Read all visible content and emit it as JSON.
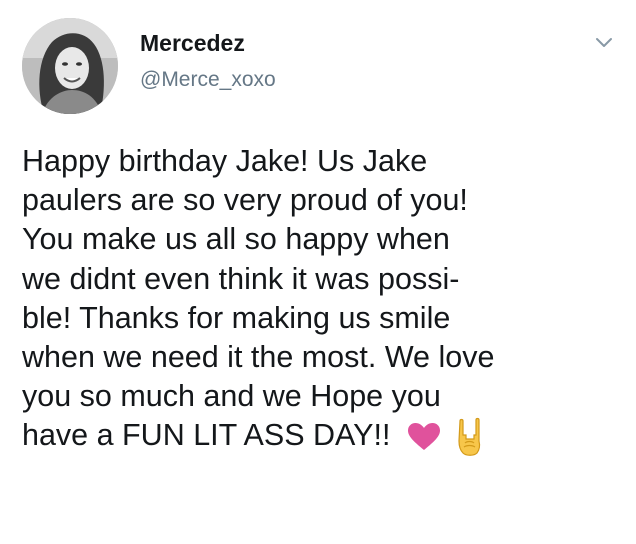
{
  "tweet": {
    "author": {
      "display_name": "Mercedez",
      "handle": "@Merce_xoxo"
    },
    "body_lines": [
      "Happy birthday Jake! Us Jake",
      "paulers are so very proud of you!",
      "You make us all so happy when",
      "we didnt even think it was possi-",
      "ble! Thanks for making us smile",
      "when we need it the most. We love",
      "you so much and we Hope you",
      "have a FUN LIT ASS DAY!!"
    ],
    "emojis": [
      "heart-icon",
      "sign-of-the-horns-icon"
    ],
    "menu_icon": "chevron-down-icon"
  },
  "colors": {
    "text": "#14171a",
    "secondary_text": "#657786",
    "heart": "#e0529c",
    "hand": "#f7c64a"
  }
}
